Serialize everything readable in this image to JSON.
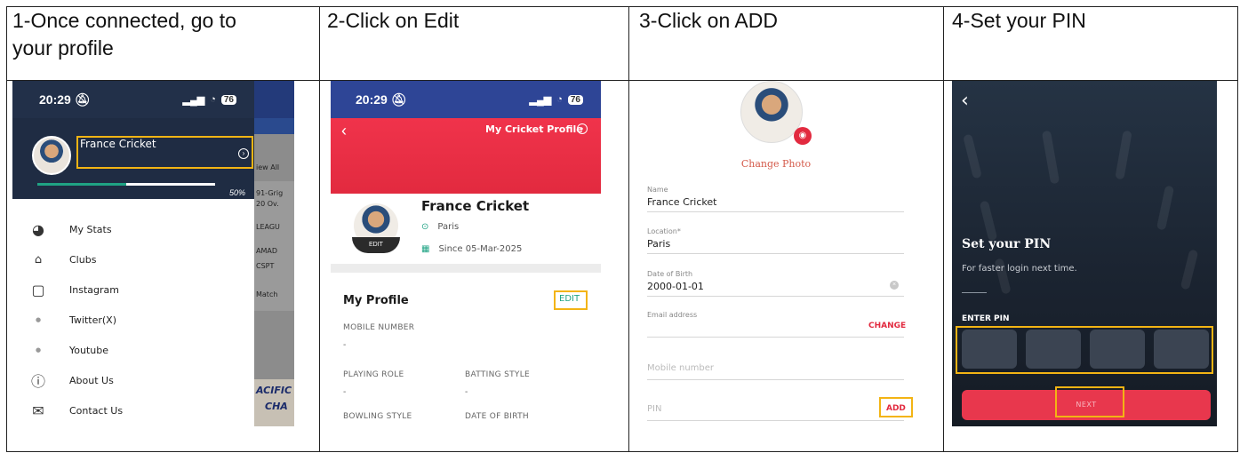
{
  "steps": [
    {
      "title_line1": "1-Once connected, go to",
      "title_line2": "your profile"
    },
    {
      "title_line1": "2-Click on Edit"
    },
    {
      "title_line1": "3-Click on ADD"
    },
    {
      "title_line1": "4-Set your PIN"
    }
  ],
  "colors": {
    "highlight": "#f3b414",
    "brand_red": "#e22a3f",
    "accent_green": "#1fa384",
    "nav_blue": "#2e4596"
  },
  "status": {
    "time": "20:29",
    "battery": "76"
  },
  "screen1": {
    "profile_name": "France Cricket",
    "progress_label": "50%",
    "progress": 0.5,
    "menu": [
      {
        "icon": "stats-icon",
        "label": "My Stats"
      },
      {
        "icon": "clubs-icon",
        "label": "Clubs"
      },
      {
        "icon": "instagram-icon",
        "label": "Instagram"
      },
      {
        "icon": "twitter-icon",
        "label": "Twitter(X)"
      },
      {
        "icon": "youtube-icon",
        "label": "Youtube"
      },
      {
        "icon": "info-icon",
        "label": "About Us"
      },
      {
        "icon": "mail-icon",
        "label": "Contact Us"
      }
    ],
    "behind": {
      "view_all": "iew All",
      "row1a": "91-Grig",
      "row1b": "20 Ov.",
      "league": "LEAGU",
      "amad": "AMAD",
      "cspt": "CSPT",
      "match": "Match",
      "banner1": "ACIFIC",
      "banner2": "CHA"
    }
  },
  "screen2": {
    "header": "My Cricket Profile",
    "name": "France Cricket",
    "location": "Paris",
    "since": "Since 05-Mar-2025",
    "edit_tag": "EDIT",
    "section_title": "My Profile",
    "edit_link": "EDIT",
    "fields": [
      {
        "label": "MOBILE NUMBER",
        "value": "-"
      },
      {
        "label": "PLAYING ROLE",
        "value": "-"
      },
      {
        "label": "BATTING STYLE",
        "value": "-"
      },
      {
        "label": "BOWLING STYLE",
        "value": ""
      },
      {
        "label": "DATE OF BIRTH",
        "value": ""
      }
    ]
  },
  "screen3": {
    "change_photo": "Change Photo",
    "name_label": "Name",
    "name_value": "France Cricket",
    "location_label": "Location*",
    "location_value": "Paris",
    "dob_label": "Date of Birth",
    "dob_value": "2000-01-01",
    "email_label": "Email address",
    "email_action": "CHANGE",
    "mobile_placeholder": "Mobile number",
    "pin_placeholder": "PIN",
    "pin_action": "ADD"
  },
  "screen4": {
    "title": "Set your PIN",
    "subtitle": "For faster login next time.",
    "enter_pin": "ENTER PIN",
    "next": "NEXT"
  }
}
